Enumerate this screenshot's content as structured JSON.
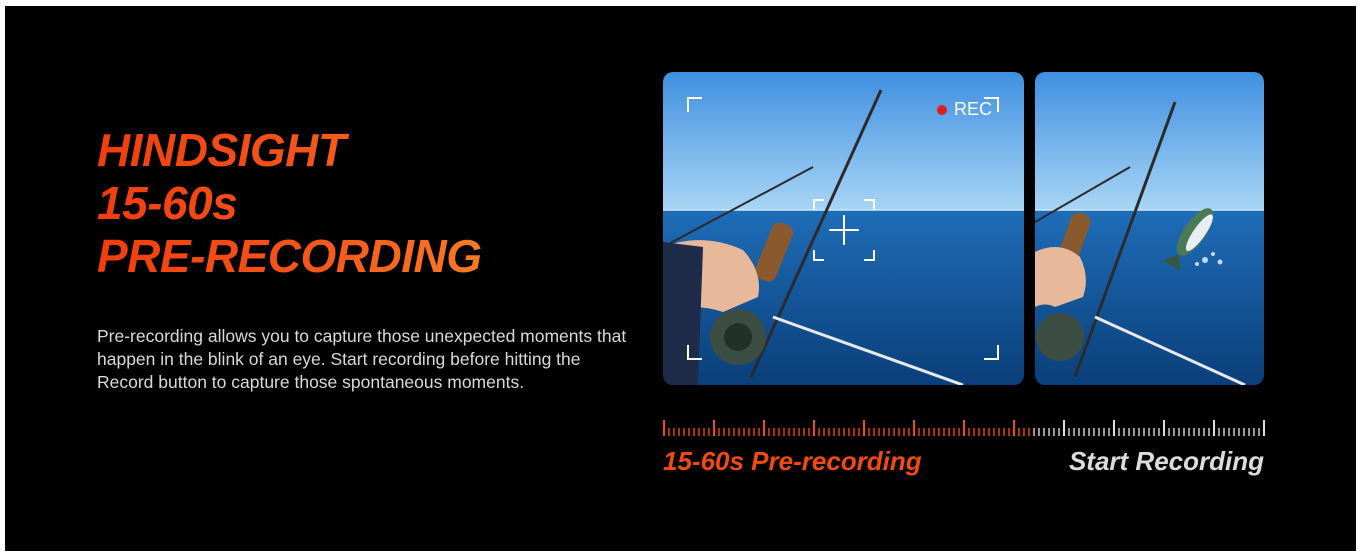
{
  "hero": {
    "headline_lines": [
      "HINDSIGHT",
      "15-60s",
      "PRE-RECORDING"
    ],
    "description": "Pre-recording allows you to capture those unexpected moments that happen in the blink of an eye. Start recording before hitting the Record button to capture those spontaneous moments."
  },
  "preview": {
    "rec_label": "REC"
  },
  "timeline": {
    "pre_label": "15-60s Pre-recording",
    "start_label": "Start Recording",
    "pre_color": "#f24a12",
    "post_color": "#dcdcdc"
  },
  "colors": {
    "background": "#000000",
    "accent": "#f24a12",
    "rec_dot": "#e01e1e"
  }
}
